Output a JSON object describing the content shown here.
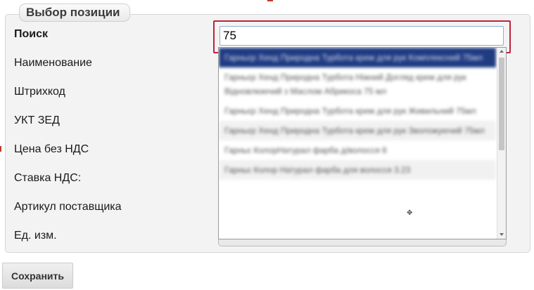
{
  "panel": {
    "title": "Выбор позиции"
  },
  "fields": [
    {
      "label": "Поиск"
    },
    {
      "label": "Наименование"
    },
    {
      "label": "Штрихкод"
    },
    {
      "label": "УКТ ЗЕД"
    },
    {
      "label": "Цена без НДС"
    },
    {
      "label": "Ставка НДС:"
    },
    {
      "label": "Артикул поставщика"
    },
    {
      "label": "Ед. изм."
    }
  ],
  "search": {
    "value": "75"
  },
  "dropdown": {
    "items": [
      {
        "text": "Гарньєр Хенд Природна Турбота крем для рук Комплексний 75мл"
      },
      {
        "text": "Гарньєр Хенд Природна Турбота Ніжний Догляд крем для рук Відновлюючий з Маслом Абрикоса 75 мл"
      },
      {
        "text": "Гарньєр Хенд Природна Турбота крем для рук Живильний 75мл"
      },
      {
        "text": "Гарньєр Хенд Природна Турбота крем для рук Зволожуючий 75мл"
      },
      {
        "text": "Гарньє КолорНатурал фарба д/волосся 6"
      },
      {
        "text": "Гарньє Колор Натурал фарба для волосся 3.23"
      }
    ]
  },
  "actions": {
    "save_label": "Сохранить"
  }
}
